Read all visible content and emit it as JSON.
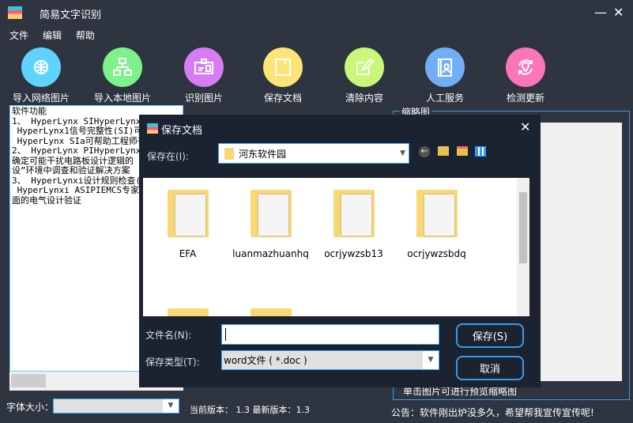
{
  "app": {
    "title": "简易文字识别",
    "menu": [
      "文件",
      "编辑",
      "帮助"
    ],
    "minimize": "—",
    "close": "✕"
  },
  "toolbar": [
    {
      "label": "导入网络图片",
      "icon": "globe-network-icon",
      "color": "#5fd3fb"
    },
    {
      "label": "导入本地图片",
      "icon": "local-network-icon",
      "color": "#7ef28a"
    },
    {
      "label": "识别图片",
      "icon": "id-card-icon",
      "color": "#d67cf5"
    },
    {
      "label": "保存文档",
      "icon": "floppy-save-icon",
      "color": "#fde476"
    },
    {
      "label": "清除内容",
      "icon": "edit-icon",
      "color": "#c9f77a"
    },
    {
      "label": "人工服务",
      "icon": "contact-book-icon",
      "color": "#72aef5"
    },
    {
      "label": "检测更新",
      "icon": "refresh-location-icon",
      "color": "#fb76b8"
    }
  ],
  "editor": {
    "text": "软件功能\n1、 HyperLynx SIHyperLynx1信\n HyperLynx1信号完整性(SI)可\n HyperLynx SIa可帮助工程师有\n2、 HyperLynx PIHyperLynx电\n确定可能干扰电路板设计逻辑的\n设”环境中调查和验证解决方案\n3、 HyperLynxi设计规则检查(\n HyperLynxi ASIPIEMCS专家提\n面的电气设计验证"
  },
  "font_size": {
    "label": "字体大小：",
    "value": ""
  },
  "version": "当前版本： 1.3 最新版本：1.3",
  "thumbnail": {
    "title": "缩略图",
    "caption": "单击图片可进行预览缩略图"
  },
  "notice": "公告：软件刚出炉没多久，希望帮我宣传宣传呢!",
  "dialog": {
    "title": "保存文档",
    "close": "✕",
    "save_in_label": "保存在(I):",
    "save_in_value": "河东软件园",
    "folders": [
      "EFA",
      "luanmazhuanhq",
      "ocrjywzsb13",
      "ocrjywzsbdq"
    ],
    "filename_label": "文件名(N):",
    "filename_value": "",
    "filetype_label": "保存类型(T):",
    "filetype_value": "word文件 ( *.doc )",
    "save_button": "保存(S)",
    "cancel_button": "取消"
  }
}
